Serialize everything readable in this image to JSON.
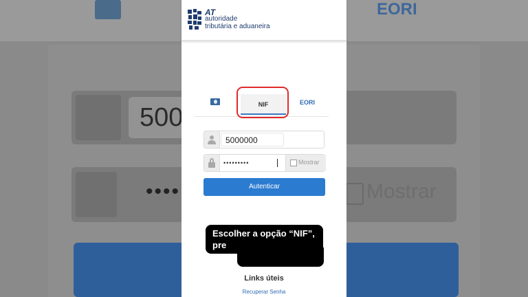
{
  "background": {
    "user_value": "500",
    "password_dots": "••••",
    "show_label": "Mostrar",
    "eori_label": "EORI"
  },
  "header": {
    "logo_at": "AT",
    "logo_line1": "autoridade",
    "logo_line2": "tributária e aduaneira"
  },
  "tabs": {
    "nif": "NIF",
    "eori": "EORI"
  },
  "form": {
    "nif_value": "5000000",
    "password_dots": "•••••••••",
    "show_label": "Mostrar",
    "submit_label": "Autenticar"
  },
  "footer": {
    "links_title": "Links úteis",
    "recover_link": "Recuperar Senha"
  },
  "caption": {
    "text": "Escolher a opção “NIF”, pre"
  },
  "colors": {
    "brand_blue": "#2b7bd0",
    "highlight_red": "#e02a2a",
    "logo_navy": "#1f3c6e"
  }
}
